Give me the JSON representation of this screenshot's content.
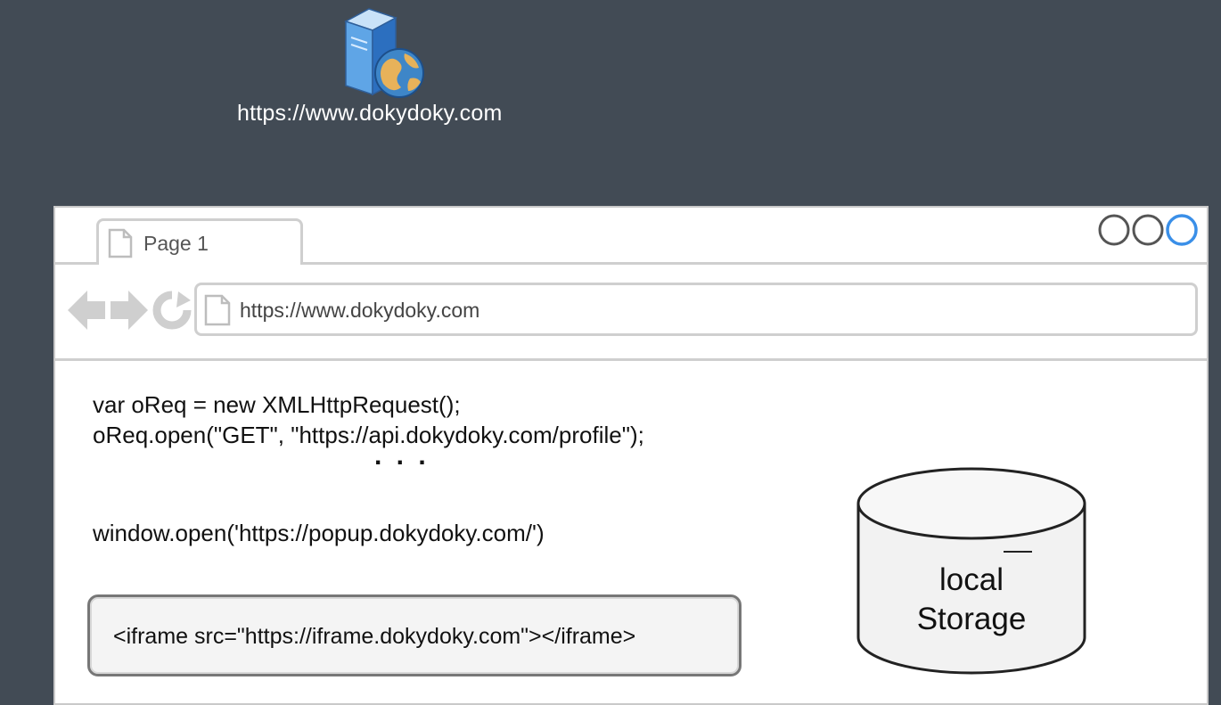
{
  "server": {
    "url": "https://www.dokydoky.com",
    "icon": "server-globe-icon"
  },
  "browser": {
    "tab": {
      "label": "Page 1",
      "icon": "page-icon"
    },
    "window_buttons": [
      "circle-button",
      "circle-button",
      "circle-button-active"
    ],
    "nav_icons": [
      "back-arrow-icon",
      "forward-arrow-icon",
      "reload-icon"
    ],
    "address": "https://www.dokydoky.com",
    "code": {
      "line1": "var oReq = new XMLHttpRequest();",
      "line2": "oReq.open(\"GET\", \"https://api.dokydoky.com/profile\");",
      "ellipsis": ". . .",
      "line3": "window.open('https://popup.dokydoky.com/')"
    },
    "iframe": "<iframe src=\"https://iframe.dokydoky.com\"></iframe>",
    "storage": {
      "line1": "local",
      "line2": "Storage"
    }
  },
  "colors": {
    "background": "#424b55",
    "border": "#cfcfcf",
    "active_button": "#3a8fe8"
  }
}
